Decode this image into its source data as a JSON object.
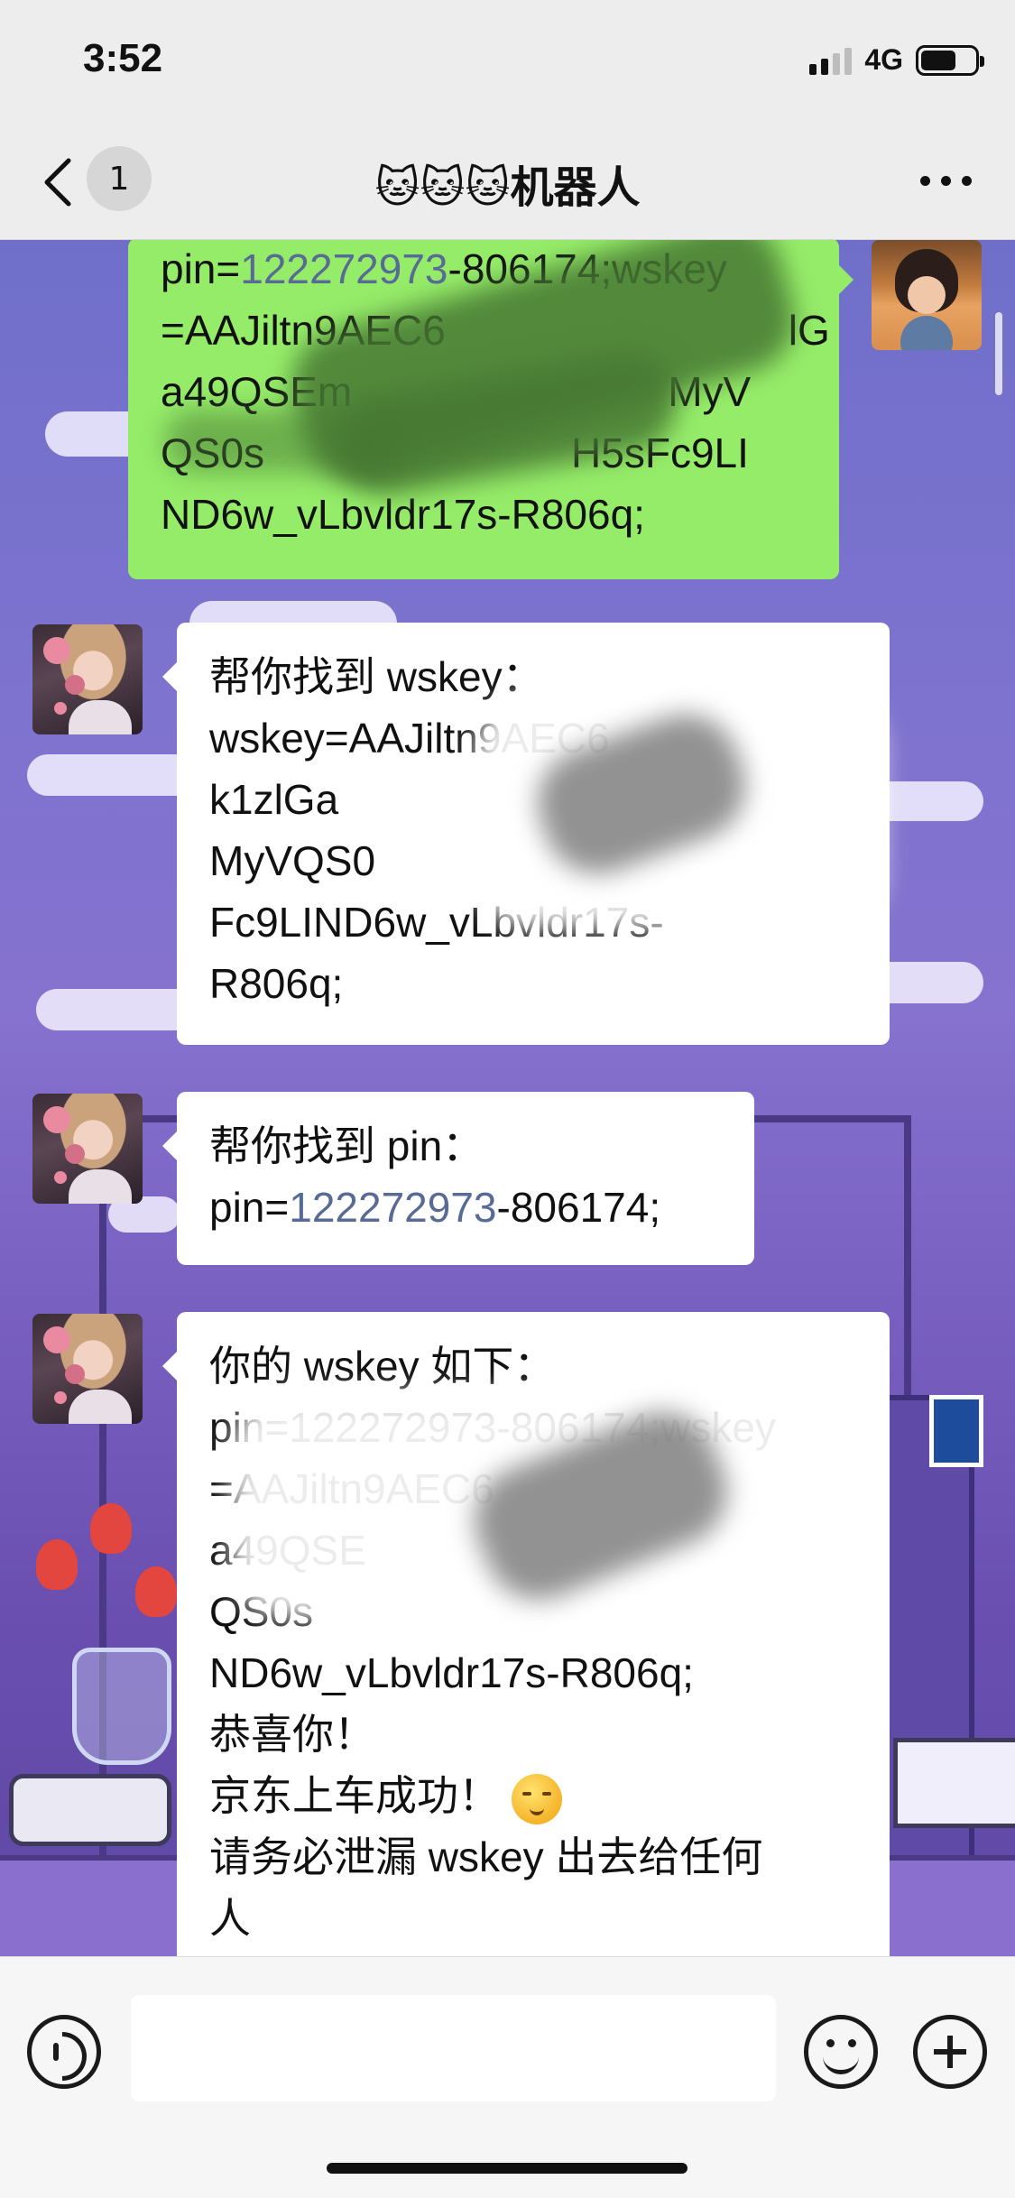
{
  "status_bar": {
    "time": "3:52",
    "network": "4G",
    "battery_level": 0.66
  },
  "nav": {
    "unread_count": "1",
    "title": "🐱🐱🐱机器人"
  },
  "messages": [
    {
      "sender": "me",
      "lines": [
        {
          "pre": "pin=",
          "num": "122272973",
          "post": "-806174;wskey"
        },
        {
          "pre": "=AAJiltn9AEC6",
          "num": "",
          "post": "lG"
        },
        {
          "pre": "a49QSEm",
          "num": "",
          "post": "MyV"
        },
        {
          "pre": "QS0s",
          "num": "",
          "post": "H5sFc9LI"
        },
        {
          "pre": "ND6w_vLbvldr17s-R806q;",
          "num": "",
          "post": ""
        }
      ]
    },
    {
      "sender": "bot",
      "lines": [
        "帮你找到 wskey：",
        "wskey=AAJiltn9AEC6",
        "k1zlGa",
        "MyVQS0",
        "Fc9LIND6w_vLbvldr17s-",
        "R806q;"
      ]
    },
    {
      "sender": "bot",
      "lines": [
        {
          "pre": "帮你找到 pin：",
          "num": "",
          "post": ""
        },
        {
          "pre": "pin=",
          "num": "122272973",
          "post": "-806174;"
        }
      ]
    },
    {
      "sender": "bot",
      "lines": [
        "你的 wskey 如下：",
        "pin=122272973-806174;wskey",
        "=AAJiltn9AEC6",
        "a49QSE",
        "QS0s",
        "ND6w_vLbvldr17s-R806q;",
        "恭喜你！",
        "京东上车成功！",
        "请务必泄漏 wskey 出去给任何",
        "人"
      ]
    }
  ],
  "input": {
    "placeholder": ""
  },
  "icons": {
    "back": "chevron-left-icon",
    "more": "more-dots-icon",
    "voice": "voice-icon",
    "emoji": "emoji-icon",
    "plus": "plus-icon",
    "blush": "blush-emoji-icon"
  },
  "colors": {
    "accent_link": "#576b95",
    "bubble_out": "#95ec69",
    "bubble_in": "#ffffff",
    "bar_bg": "#ededed"
  }
}
